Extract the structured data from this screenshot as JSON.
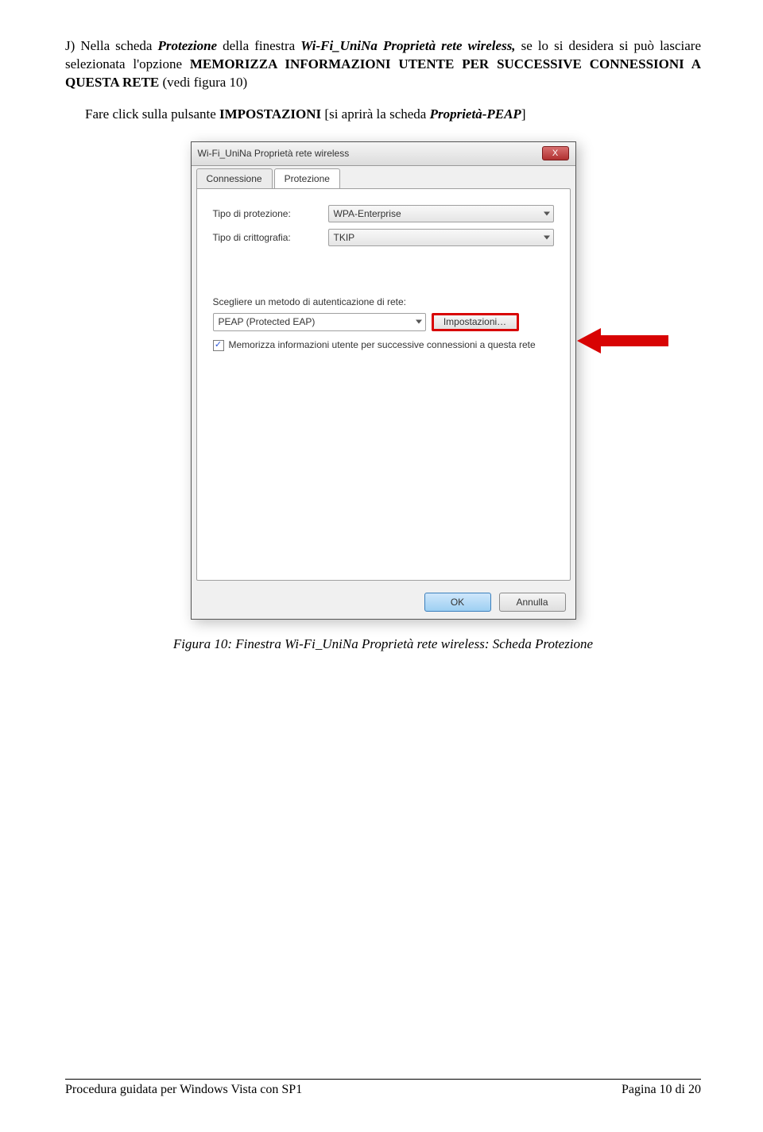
{
  "para1": {
    "lead": "J) Nella scheda ",
    "t1": "Protezione",
    "mid1": " della finestra ",
    "t2": "Wi-Fi_UniNa Proprietà rete wireless,",
    "mid2": " se lo si desidera si può lasciare selezionata l'opzione ",
    "opt": "MEMORIZZA INFORMAZIONI UTENTE PER SUCCESSIVE CONNESSIONI A QUESTA RETE",
    "tail": " (vedi figura 10)"
  },
  "para2": {
    "t0": "Fare click sulla pulsante ",
    "t1": "IMPOSTAZIONI",
    "t2": " [si aprirà la scheda ",
    "t3": "Proprietà-PEAP",
    "t4": "]"
  },
  "dialog": {
    "title": "Wi-Fi_UniNa Proprietà rete wireless",
    "tabs": {
      "t1": "Connessione",
      "t2": "Protezione"
    },
    "sec_type_label": "Tipo di protezione:",
    "sec_type_value": "WPA-Enterprise",
    "enc_type_label": "Tipo di crittografia:",
    "enc_type_value": "TKIP",
    "auth_label": "Scegliere un metodo di autenticazione di rete:",
    "auth_value": "PEAP (Protected EAP)",
    "impost_button": "Impostazioni…",
    "cb_text": "Memorizza informazioni utente per successive connessioni a questa rete",
    "ok": "OK",
    "cancel": "Annulla",
    "close": "X"
  },
  "caption": "Figura 10: Finestra Wi-Fi_UniNa Proprietà rete wireless: Scheda Protezione",
  "footer": {
    "left": "Procedura guidata per Windows Vista con SP1",
    "right": "Pagina 10 di 20"
  }
}
